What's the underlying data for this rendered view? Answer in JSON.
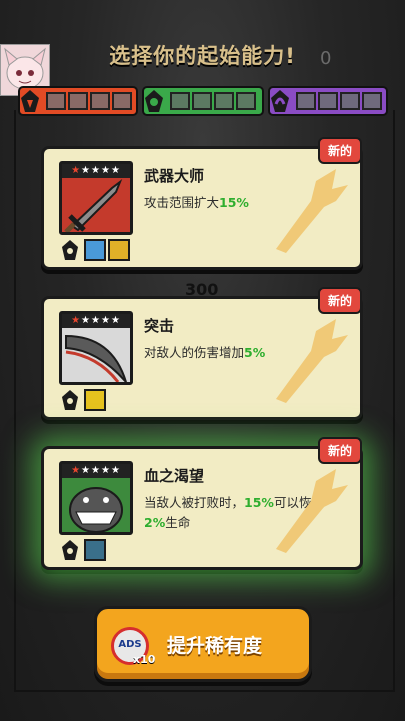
{
  "header": {
    "title": "选择你的起始能力!",
    "counter_value": "0",
    "score": "300"
  },
  "rarity_bars": [
    {
      "color": "red",
      "icon": "rage-icon",
      "cells": 4
    },
    {
      "color": "green",
      "icon": "nature-icon",
      "cells": 4
    },
    {
      "color": "purple",
      "icon": "arcane-icon",
      "cells": 4
    }
  ],
  "cards": [
    {
      "badge": "新的",
      "name": "武器大师",
      "desc_prefix": "攻击范围扩大",
      "desc_pct": "15%",
      "desc_mid": "",
      "desc_pct2": "",
      "desc_suffix": "",
      "stars": "★★★★★",
      "stars_filled": 1,
      "portrait": "sword-icon",
      "tags": [
        "weapon-upgrade-icon",
        "crown-icon"
      ]
    },
    {
      "badge": "新的",
      "name": "突击",
      "desc_prefix": "对敌人的伤害增加",
      "desc_pct": "5%",
      "desc_mid": "",
      "desc_pct2": "",
      "desc_suffix": "",
      "stars": "★★★★★",
      "stars_filled": 1,
      "portrait": "slash-icon",
      "tags": [
        "gold-coin-icon"
      ]
    },
    {
      "badge": "新的",
      "name": "血之渴望",
      "desc_prefix": "当敌人被打败时，",
      "desc_pct": "15%",
      "desc_mid": "可以恢复",
      "desc_pct2": "2%",
      "desc_suffix": "生命",
      "stars": "★★★★★",
      "stars_filled": 1,
      "portrait": "monster-icon",
      "tags": [
        "shield-icon"
      ]
    }
  ],
  "upgrade_button": {
    "label": "提升稀有度",
    "ads_label": "ADS",
    "ads_count": "x10"
  },
  "colors": {
    "card_bg": "#f2ecc4",
    "badge": "#e2473d",
    "button": "#f3a51e",
    "highlight_glow": "#5adc50"
  }
}
